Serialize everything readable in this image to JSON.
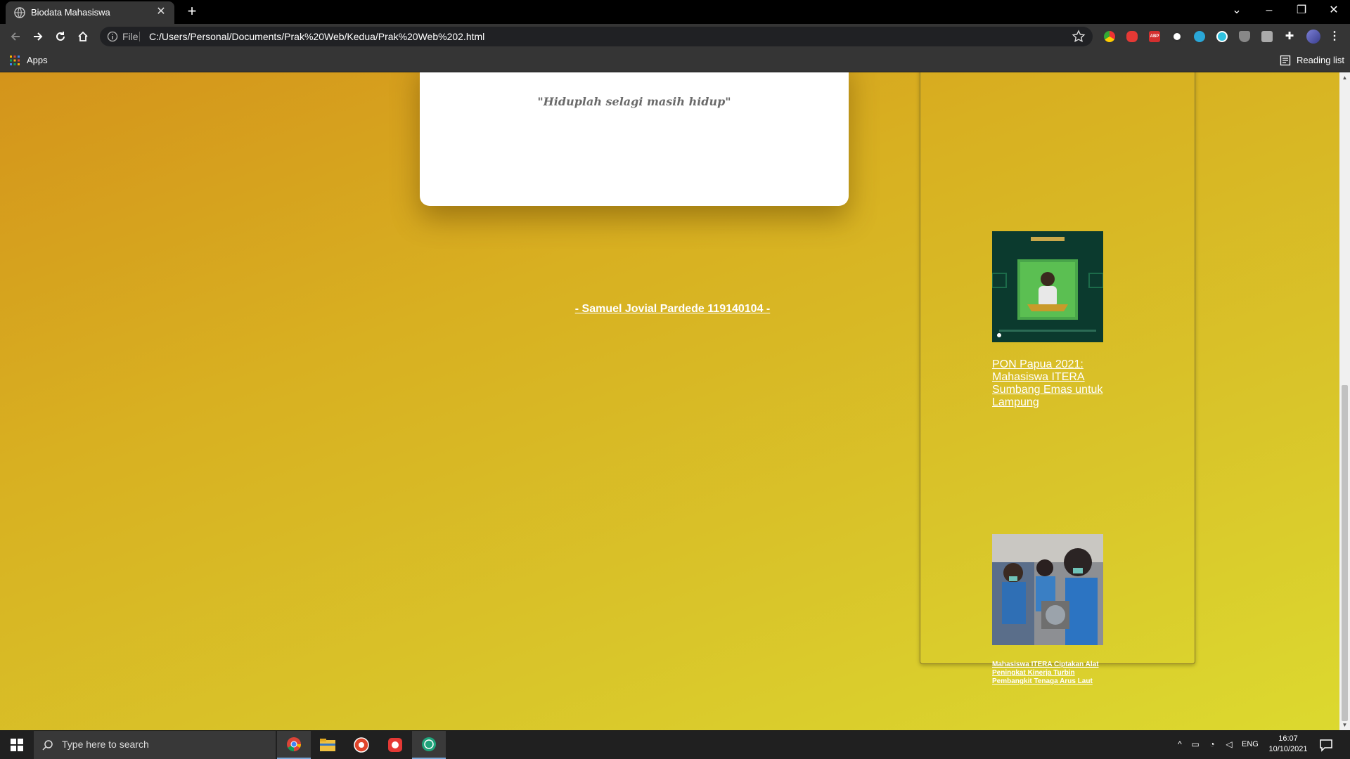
{
  "browser": {
    "tab_title": "Biodata Mahasiswa",
    "new_tab_label": "+",
    "scheme_label": "File",
    "url": "C:/Users/Personal/Documents/Prak%20Web/Kedua/Prak%20Web%202.html",
    "bookmarks": {
      "apps_label": "Apps",
      "reading_list_label": "Reading list"
    }
  },
  "page": {
    "quote": "\"Hiduplah selagi masih hidup\"",
    "author_link": "- Samuel Jovial Pardede 119140104 -",
    "news": [
      {
        "title": "PON Papua 2021: Mahasiswa ITERA Sumbang Emas untuk Lampung"
      },
      {
        "title": "Mahasiswa ITERA Ciptakan Alat Peningkat Kinerja Turbin Pembangkit Tenaga Arus Laut"
      }
    ]
  },
  "taskbar": {
    "search_placeholder": "Type here to search",
    "language": "ENG",
    "time": "16:07",
    "date": "10/10/2021"
  }
}
